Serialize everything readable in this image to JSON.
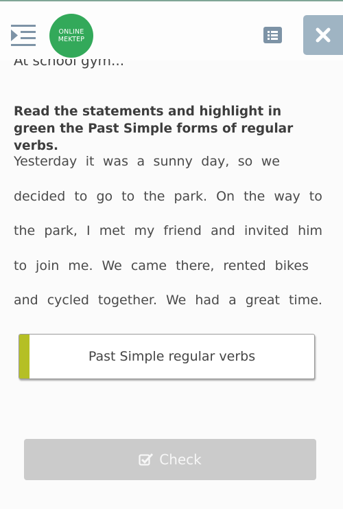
{
  "header": {
    "logo": {
      "line1": "ONLINE",
      "line2": "MEKTEP",
      "color": "#33a95a"
    },
    "menu_toggle_icon": "indent-menu-icon",
    "toc_icon": "list-icon",
    "close_icon": "close-icon"
  },
  "clipped_title": "At school gym...",
  "exercise": {
    "instruction": "Read the statements and highlight in green the Past Simple forms of regular verbs.",
    "passage_lines": [
      [
        "Yesterday",
        "it",
        "was",
        "a",
        "sunny",
        "day,",
        "so",
        "we"
      ],
      [
        "decided",
        "to",
        "go",
        "to",
        "the",
        "park.",
        "On",
        "the",
        "way",
        "to"
      ],
      [
        "the",
        "park,",
        "I",
        "met",
        "my",
        "friend",
        "and",
        "invited",
        "him"
      ],
      [
        "to",
        "join",
        "me.",
        "We",
        "came",
        "there,",
        "rented",
        "bikes"
      ],
      [
        "and",
        "cycled",
        "together.",
        "We",
        "had",
        "a",
        "great",
        "time."
      ]
    ]
  },
  "category": {
    "label": "Past Simple regular verbs",
    "accent_color": "#b5bf25"
  },
  "check_button": {
    "label": "Check",
    "icon": "checkbox-icon",
    "enabled": false
  }
}
